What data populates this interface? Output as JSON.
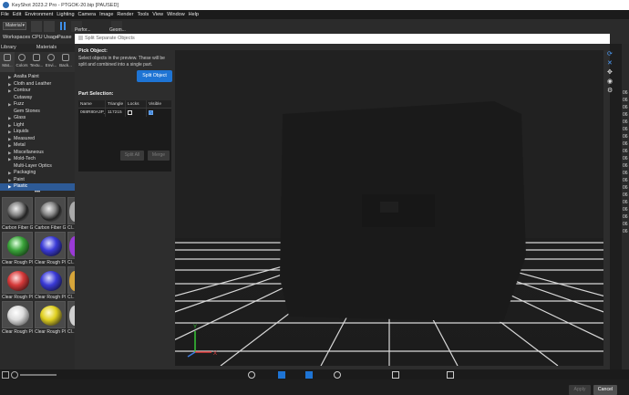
{
  "window": {
    "title": "KeyShot 2023.2 Pro  -  PTGOK-20.bip [PAUSED]"
  },
  "menu": [
    "File",
    "Edit",
    "Environment",
    "Lighting",
    "Camera",
    "Image",
    "Render",
    "Tools",
    "View",
    "Window",
    "Help"
  ],
  "toolbar": {
    "material_select": "Material",
    "workspaces": "Workspaces",
    "cpu_usage": "CPU Usage",
    "pause": "Pause",
    "tb_extra1": "Perfor...",
    "tb_extra2": "Geom..."
  },
  "left_panel": {
    "header_left": "Library",
    "header_right": "Materials",
    "tabs": [
      "Mat...",
      "Colors",
      "Textu...",
      "Envi...",
      "Back..."
    ],
    "tree": [
      {
        "label": "Axalta Paint",
        "expandable": true
      },
      {
        "label": "Cloth and Leather",
        "expandable": true
      },
      {
        "label": "Contour",
        "expandable": true
      },
      {
        "label": "Cutaway",
        "expandable": false
      },
      {
        "label": "Fuzz",
        "expandable": true
      },
      {
        "label": "Gem Stones",
        "expandable": false
      },
      {
        "label": "Glass",
        "expandable": true
      },
      {
        "label": "Light",
        "expandable": true
      },
      {
        "label": "Liquids",
        "expandable": true
      },
      {
        "label": "Measured",
        "expandable": true
      },
      {
        "label": "Metal",
        "expandable": true
      },
      {
        "label": "Miscellaneous",
        "expandable": true
      },
      {
        "label": "Mold-Tech",
        "expandable": true
      },
      {
        "label": "Multi-Layer Optics",
        "expandable": false
      },
      {
        "label": "Packaging",
        "expandable": true
      },
      {
        "label": "Paint",
        "expandable": true
      },
      {
        "label": "Plastic",
        "expandable": true,
        "selected": true
      }
    ],
    "thumbnails": [
      {
        "label": "Carbon Fiber Gl...",
        "color": "#cfcfcf"
      },
      {
        "label": "Carbon Fiber Gl...",
        "color": "#cfcfcf"
      },
      {
        "label": "Cl...",
        "color": "#cfcfcf"
      },
      {
        "label": "Clear Rough Pl...",
        "color": "#3aa33a"
      },
      {
        "label": "Clear Rough Pl...",
        "color": "#3a3ad6"
      },
      {
        "label": "Cl...",
        "color": "#9a3ad6"
      },
      {
        "label": "Clear Rough Pl...",
        "color": "#d63a3a"
      },
      {
        "label": "Clear Rough Pl...",
        "color": "#3a3ad6"
      },
      {
        "label": "Cl...",
        "color": "#d6a53a"
      },
      {
        "label": "Clear Rough Pl...",
        "color": "#dcdcdc"
      },
      {
        "label": "Clear Rough Pl...",
        "color": "#e0d020"
      },
      {
        "label": "Cl...",
        "color": "#cfcfcf"
      }
    ]
  },
  "dialog": {
    "title": "Split Separate Objects",
    "pick_object_heading": "Pick Object:",
    "pick_object_text": "Select objects in the preview. These will be split and combined into a single part.",
    "split_object_button": "Split Object",
    "part_selection_heading": "Part Selection:",
    "table": {
      "columns": [
        "Name",
        "Triangle",
        "Locks",
        "Visible"
      ],
      "rows": [
        {
          "name": "068R80A3P_1",
          "triangles": "117215",
          "locked": false,
          "visible": true
        }
      ]
    },
    "split_all_button": "Split All",
    "merge_button": "Merge",
    "apply_button": "Apply",
    "cancel_button": "Cancel",
    "axis_labels": {
      "x": "X",
      "y": "Y"
    }
  },
  "right_strip_numbers": [
    "06",
    "06",
    "06",
    "06",
    "06",
    "06",
    "06",
    "06",
    "06",
    "06",
    "06",
    "06",
    "06",
    "06",
    "06",
    "06",
    "06",
    "06",
    "06",
    "06"
  ],
  "colors": {
    "accent": "#1e74d4",
    "selection": "#2d5a96",
    "viewport_bg": "#202020",
    "grid": "#d8d8d8"
  }
}
